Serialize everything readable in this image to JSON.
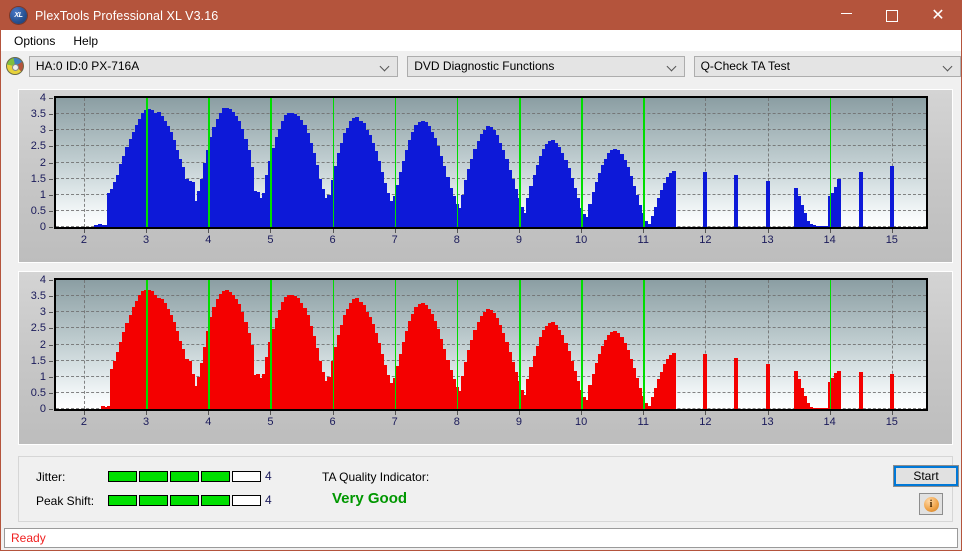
{
  "window": {
    "title": "PlexTools Professional XL V3.16",
    "app_icon": "xl-logo-icon",
    "minimize_label": "Minimize",
    "maximize_label": "Maximize",
    "close_label": "✕"
  },
  "menu": {
    "items": [
      {
        "label": "Options"
      },
      {
        "label": "Help"
      }
    ]
  },
  "toolbar": {
    "drive_icon": "optical-disc-icon",
    "drive_value": "HA:0 ID:0  PX-716A",
    "function_value": "DVD Diagnostic Functions",
    "test_value": "Q-Check TA Test"
  },
  "charts": {
    "y_labels": [
      "4",
      "3.5",
      "3",
      "2.5",
      "2",
      "1.5",
      "1",
      "0.5",
      "0"
    ],
    "x_labels": [
      "2",
      "3",
      "4",
      "5",
      "6",
      "7",
      "8",
      "9",
      "10",
      "11",
      "12",
      "13",
      "14",
      "15"
    ]
  },
  "chart_data": [
    {
      "type": "bar",
      "id": "jitter-chart",
      "title": "Q-Check TA Test — Jitter (top plot)",
      "xlabel": "",
      "ylabel": "",
      "color": "#0d19d8",
      "marker_color": "#00dd00",
      "grid": true,
      "xlim": [
        1.55,
        15.55
      ],
      "ylim": [
        0,
        4
      ],
      "yticks": [
        0,
        0.5,
        1,
        1.5,
        2,
        2.5,
        3,
        3.5,
        4
      ],
      "xticks": [
        2,
        3,
        4,
        5,
        6,
        7,
        8,
        9,
        10,
        11,
        12,
        13,
        14,
        15
      ],
      "markers_x": [
        3,
        4,
        5,
        6,
        7,
        8,
        9,
        10,
        11,
        14
      ],
      "x": [
        2.0,
        2.05,
        2.1,
        2.15,
        2.2,
        2.25,
        2.3,
        2.35,
        2.4,
        2.45,
        2.5,
        2.55,
        2.6,
        2.65,
        2.7,
        2.75,
        2.8,
        2.85,
        2.9,
        2.95,
        3.0,
        3.05,
        3.1,
        3.15,
        3.2,
        3.25,
        3.3,
        3.35,
        3.4,
        3.45,
        3.5,
        3.55,
        3.6,
        3.65,
        3.7,
        3.75,
        3.8,
        3.85,
        3.9,
        3.95,
        4.0,
        4.05,
        4.1,
        4.15,
        4.2,
        4.25,
        4.3,
        4.35,
        4.4,
        4.45,
        4.5,
        4.55,
        4.6,
        4.65,
        4.7,
        4.75,
        4.8,
        4.85,
        4.9,
        4.95,
        5.0,
        5.05,
        5.1,
        5.15,
        5.2,
        5.25,
        5.3,
        5.35,
        5.4,
        5.45,
        5.5,
        5.55,
        5.6,
        5.65,
        5.7,
        5.75,
        5.8,
        5.85,
        5.9,
        5.95,
        6.0,
        6.05,
        6.1,
        6.15,
        6.2,
        6.25,
        6.3,
        6.35,
        6.4,
        6.45,
        6.5,
        6.55,
        6.6,
        6.65,
        6.7,
        6.75,
        6.8,
        6.85,
        6.9,
        6.95,
        7.0,
        7.05,
        7.1,
        7.15,
        7.2,
        7.25,
        7.3,
        7.35,
        7.4,
        7.45,
        7.5,
        7.55,
        7.6,
        7.65,
        7.7,
        7.75,
        7.8,
        7.85,
        7.9,
        7.95,
        8.0,
        8.05,
        8.1,
        8.15,
        8.2,
        8.25,
        8.3,
        8.35,
        8.4,
        8.45,
        8.5,
        8.55,
        8.6,
        8.65,
        8.7,
        8.75,
        8.8,
        8.85,
        8.9,
        8.95,
        9.0,
        9.05,
        9.1,
        9.15,
        9.2,
        9.25,
        9.3,
        9.35,
        9.4,
        9.45,
        9.5,
        9.55,
        9.6,
        9.65,
        9.7,
        9.75,
        9.8,
        9.85,
        9.9,
        9.95,
        10.0,
        10.05,
        10.1,
        10.15,
        10.2,
        10.25,
        10.3,
        10.35,
        10.4,
        10.45,
        10.5,
        10.55,
        10.6,
        10.65,
        10.7,
        10.75,
        10.8,
        10.85,
        10.9,
        10.95,
        11.0,
        11.05,
        11.1,
        11.15,
        11.2,
        11.25,
        11.3,
        11.35,
        11.4,
        11.45,
        11.5,
        12.0,
        12.5,
        13.0,
        13.45,
        13.5,
        13.55,
        13.6,
        13.65,
        13.7,
        13.75,
        13.8,
        13.85,
        13.9,
        13.95,
        14.0,
        14.05,
        14.1,
        14.15,
        14.5,
        15.0
      ],
      "values": [
        0.0,
        0.0,
        0.0,
        0.0,
        0.05,
        0.08,
        0.07,
        0.06,
        1.07,
        1.17,
        1.4,
        1.62,
        1.95,
        2.2,
        2.48,
        2.72,
        2.95,
        3.15,
        3.35,
        3.52,
        3.63,
        3.65,
        3.62,
        3.55,
        3.58,
        3.45,
        3.3,
        3.12,
        2.95,
        2.7,
        2.4,
        2.1,
        1.85,
        1.48,
        1.42,
        1.4,
        0.8,
        1.12,
        1.5,
        2.0,
        2.4,
        2.8,
        3.1,
        3.35,
        3.55,
        3.68,
        3.7,
        3.66,
        3.58,
        3.45,
        3.28,
        3.05,
        2.72,
        2.38,
        1.85,
        1.12,
        1.1,
        0.9,
        1.05,
        1.6,
        2.05,
        2.45,
        2.8,
        3.05,
        3.3,
        3.48,
        3.55,
        3.52,
        3.5,
        3.45,
        3.32,
        3.15,
        2.92,
        2.6,
        2.28,
        1.92,
        1.5,
        1.18,
        0.9,
        1.0,
        1.45,
        1.9,
        2.28,
        2.6,
        2.9,
        3.08,
        3.28,
        3.38,
        3.42,
        3.3,
        3.22,
        3.0,
        2.85,
        2.62,
        2.35,
        2.05,
        1.72,
        1.38,
        1.05,
        0.82,
        0.96,
        1.3,
        1.7,
        2.05,
        2.4,
        2.7,
        2.95,
        3.15,
        3.25,
        3.3,
        3.25,
        3.12,
        2.95,
        2.75,
        2.5,
        2.2,
        1.88,
        1.55,
        1.22,
        0.96,
        0.7,
        0.58,
        1.0,
        1.45,
        1.8,
        2.12,
        2.42,
        2.68,
        2.88,
        3.02,
        3.12,
        3.1,
        3.0,
        2.85,
        2.62,
        2.38,
        2.1,
        1.78,
        1.48,
        1.18,
        0.9,
        0.62,
        0.45,
        0.9,
        1.28,
        1.62,
        1.92,
        2.2,
        2.42,
        2.58,
        2.68,
        2.7,
        2.62,
        2.48,
        2.3,
        2.08,
        1.82,
        1.52,
        1.2,
        0.9,
        0.6,
        0.4,
        0.3,
        0.72,
        1.08,
        1.4,
        1.68,
        1.92,
        2.12,
        2.28,
        2.38,
        2.42,
        2.38,
        2.25,
        2.08,
        1.85,
        1.58,
        1.28,
        0.98,
        0.68,
        0.42,
        0.2,
        0.1,
        0.35,
        0.62,
        0.9,
        1.15,
        1.38,
        1.55,
        1.68,
        1.75,
        1.72,
        1.6,
        1.42,
        1.2,
        0.95,
        0.68,
        0.42,
        0.2,
        0.08,
        0.05,
        0.02,
        0.02,
        0.02,
        0.02,
        0.95,
        1.05,
        1.25,
        1.48,
        1.7,
        1.9,
        2.08,
        2.18,
        2.22,
        2.18,
        2.05,
        1.88,
        1.62,
        1.3,
        0.95,
        0.02,
        0.02
      ]
    },
    {
      "type": "bar",
      "id": "peak-shift-chart",
      "title": "Q-Check TA Test — Peak Shift (bottom plot)",
      "xlabel": "",
      "ylabel": "",
      "color": "#f40000",
      "marker_color": "#00dd00",
      "grid": true,
      "xlim": [
        1.55,
        15.55
      ],
      "ylim": [
        0,
        4
      ],
      "yticks": [
        0,
        0.5,
        1,
        1.5,
        2,
        2.5,
        3,
        3.5,
        4
      ],
      "xticks": [
        2,
        3,
        4,
        5,
        6,
        7,
        8,
        9,
        10,
        11,
        12,
        13,
        14,
        15
      ],
      "markers_x": [
        3,
        4,
        5,
        6,
        7,
        8,
        9,
        10,
        11,
        14
      ],
      "x": [
        2.0,
        2.05,
        2.1,
        2.15,
        2.2,
        2.25,
        2.3,
        2.35,
        2.4,
        2.45,
        2.5,
        2.55,
        2.6,
        2.65,
        2.7,
        2.75,
        2.8,
        2.85,
        2.9,
        2.95,
        3.0,
        3.05,
        3.1,
        3.15,
        3.2,
        3.25,
        3.3,
        3.35,
        3.4,
        3.45,
        3.5,
        3.55,
        3.6,
        3.65,
        3.7,
        3.75,
        3.8,
        3.85,
        3.9,
        3.95,
        4.0,
        4.05,
        4.1,
        4.15,
        4.2,
        4.25,
        4.3,
        4.35,
        4.4,
        4.45,
        4.5,
        4.55,
        4.6,
        4.65,
        4.7,
        4.75,
        4.8,
        4.85,
        4.9,
        4.95,
        5.0,
        5.05,
        5.1,
        5.15,
        5.2,
        5.25,
        5.3,
        5.35,
        5.4,
        5.45,
        5.5,
        5.55,
        5.6,
        5.65,
        5.7,
        5.75,
        5.8,
        5.85,
        5.9,
        5.95,
        6.0,
        6.05,
        6.1,
        6.15,
        6.2,
        6.25,
        6.3,
        6.35,
        6.4,
        6.45,
        6.5,
        6.55,
        6.6,
        6.65,
        6.7,
        6.75,
        6.8,
        6.85,
        6.9,
        6.95,
        7.0,
        7.05,
        7.1,
        7.15,
        7.2,
        7.25,
        7.3,
        7.35,
        7.4,
        7.45,
        7.5,
        7.55,
        7.6,
        7.65,
        7.7,
        7.75,
        7.8,
        7.85,
        7.9,
        7.95,
        8.0,
        8.05,
        8.1,
        8.15,
        8.2,
        8.25,
        8.3,
        8.35,
        8.4,
        8.45,
        8.5,
        8.55,
        8.6,
        8.65,
        8.7,
        8.75,
        8.8,
        8.85,
        8.9,
        8.95,
        9.0,
        9.05,
        9.1,
        9.15,
        9.2,
        9.25,
        9.3,
        9.35,
        9.4,
        9.45,
        9.5,
        9.55,
        9.6,
        9.65,
        9.7,
        9.75,
        9.8,
        9.85,
        9.9,
        9.95,
        10.0,
        10.05,
        10.1,
        10.15,
        10.2,
        10.25,
        10.3,
        10.35,
        10.4,
        10.45,
        10.5,
        10.55,
        10.6,
        10.65,
        10.7,
        10.75,
        10.8,
        10.85,
        10.9,
        10.95,
        11.0,
        11.05,
        11.1,
        11.15,
        11.2,
        11.25,
        11.3,
        11.35,
        11.4,
        11.45,
        11.5,
        12.0,
        12.5,
        13.0,
        13.45,
        13.5,
        13.55,
        13.6,
        13.65,
        13.7,
        13.75,
        13.8,
        13.85,
        13.9,
        13.95,
        14.0,
        14.05,
        14.1,
        14.15,
        14.5,
        15.0
      ],
      "values": [
        0.0,
        0.0,
        0.0,
        0.0,
        0.0,
        0.0,
        0.1,
        0.05,
        0.08,
        1.25,
        1.5,
        1.78,
        2.08,
        2.38,
        2.68,
        2.92,
        3.15,
        3.35,
        3.52,
        3.66,
        3.7,
        3.7,
        3.66,
        3.55,
        3.45,
        3.4,
        3.28,
        3.1,
        2.92,
        2.7,
        2.42,
        2.12,
        1.85,
        1.55,
        1.5,
        1.08,
        0.72,
        0.98,
        1.42,
        1.92,
        2.42,
        2.85,
        3.15,
        3.42,
        3.58,
        3.66,
        3.68,
        3.62,
        3.55,
        3.42,
        3.25,
        3.02,
        2.7,
        2.35,
        1.98,
        1.05,
        1.08,
        0.95,
        1.1,
        1.62,
        2.08,
        2.48,
        2.82,
        3.08,
        3.32,
        3.48,
        3.55,
        3.54,
        3.5,
        3.44,
        3.3,
        3.12,
        2.9,
        2.58,
        2.25,
        1.9,
        1.48,
        1.15,
        0.88,
        1.0,
        1.48,
        1.92,
        2.3,
        2.62,
        2.92,
        3.1,
        3.3,
        3.4,
        3.44,
        3.32,
        3.24,
        3.02,
        2.86,
        2.64,
        2.36,
        2.06,
        1.72,
        1.38,
        1.04,
        0.8,
        0.95,
        1.32,
        1.72,
        2.08,
        2.42,
        2.72,
        2.96,
        3.16,
        3.26,
        3.3,
        3.24,
        3.1,
        2.94,
        2.74,
        2.48,
        2.18,
        1.86,
        1.52,
        1.2,
        0.94,
        0.68,
        0.56,
        1.02,
        1.46,
        1.82,
        2.14,
        2.44,
        2.7,
        2.88,
        3.02,
        3.1,
        3.08,
        2.98,
        2.82,
        2.6,
        2.36,
        2.08,
        1.76,
        1.46,
        1.16,
        0.88,
        0.6,
        0.44,
        0.92,
        1.3,
        1.64,
        1.94,
        2.22,
        2.44,
        2.58,
        2.68,
        2.7,
        2.6,
        2.46,
        2.28,
        2.06,
        1.8,
        1.5,
        1.18,
        0.88,
        0.58,
        0.38,
        0.28,
        0.74,
        1.1,
        1.42,
        1.7,
        1.94,
        2.14,
        2.3,
        2.4,
        2.42,
        2.36,
        2.24,
        2.06,
        1.82,
        1.56,
        1.26,
        0.96,
        0.66,
        0.4,
        0.18,
        0.1,
        0.36,
        0.64,
        0.92,
        1.16,
        1.4,
        1.56,
        1.68,
        1.74,
        1.7,
        1.58,
        1.4,
        1.18,
        0.92,
        0.66,
        0.4,
        0.18,
        0.06,
        0.04,
        0.02,
        0.02,
        0.02,
        0.02,
        0.85,
        0.95,
        1.12,
        1.18,
        1.16,
        1.1,
        1.02,
        0.88,
        0.7,
        0.5,
        0.3,
        0.14,
        0.06,
        0.04,
        0.02,
        0.02,
        0.02
      ]
    }
  ],
  "results": {
    "jitter_label": "Jitter:",
    "jitter_filled": 4,
    "jitter_total": 5,
    "jitter_value": "4",
    "peak_shift_label": "Peak Shift:",
    "peak_shift_filled": 4,
    "peak_shift_total": 5,
    "peak_shift_value": "4",
    "ta_label": "TA Quality Indicator:",
    "ta_value": "Very Good",
    "ta_color": "#009700",
    "start_label": "Start",
    "info_label": "i"
  },
  "status": {
    "text": "Ready"
  }
}
